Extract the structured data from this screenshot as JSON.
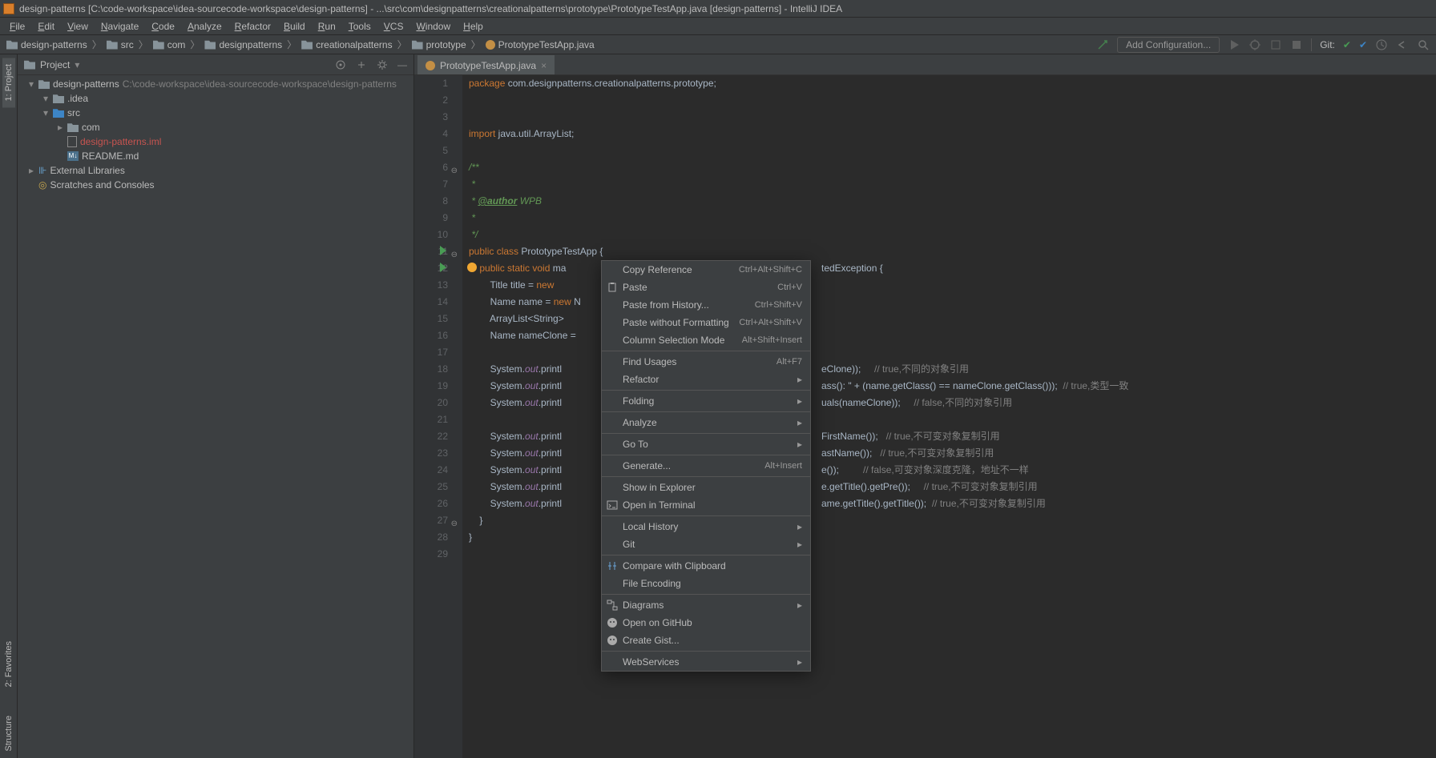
{
  "title": "design-patterns [C:\\code-workspace\\idea-sourcecode-workspace\\design-patterns] - ...\\src\\com\\designpatterns\\creationalpatterns\\prototype\\PrototypeTestApp.java [design-patterns] - IntelliJ IDEA",
  "menubar": [
    "File",
    "Edit",
    "View",
    "Navigate",
    "Code",
    "Analyze",
    "Refactor",
    "Build",
    "Run",
    "Tools",
    "VCS",
    "Window",
    "Help"
  ],
  "breadcrumbs": [
    "design-patterns",
    "src",
    "com",
    "designpatterns",
    "creationalpatterns",
    "prototype",
    "PrototypeTestApp.java"
  ],
  "navbar": {
    "addConfig": "Add Configuration...",
    "git": "Git:"
  },
  "leftTabs": {
    "project": "1: Project",
    "favorites": "2: Favorites",
    "structure": "Structure"
  },
  "panel": {
    "title": "Project",
    "tree": [
      {
        "indent": 0,
        "chev": "▾",
        "icon": "folder",
        "label": "design-patterns",
        "suffix": "C:\\code-workspace\\idea-sourcecode-workspace\\design-patterns",
        "cls": ""
      },
      {
        "indent": 1,
        "chev": "▾",
        "icon": "folder",
        "label": ".idea",
        "cls": ""
      },
      {
        "indent": 1,
        "chev": "▾",
        "icon": "folder-blue",
        "label": "src",
        "cls": ""
      },
      {
        "indent": 2,
        "chev": "▸",
        "icon": "folder",
        "label": "com",
        "cls": ""
      },
      {
        "indent": 2,
        "chev": "",
        "icon": "file",
        "label": "design-patterns.iml",
        "cls": "red"
      },
      {
        "indent": 2,
        "chev": "",
        "icon": "md",
        "label": "README.md",
        "cls": ""
      },
      {
        "indent": 0,
        "chev": "▸",
        "icon": "lib",
        "label": "External Libraries",
        "cls": ""
      },
      {
        "indent": 0,
        "chev": "",
        "icon": "scratch",
        "label": "Scratches and Consoles",
        "cls": ""
      }
    ]
  },
  "tab": {
    "label": "PrototypeTestApp.java"
  },
  "code": [
    {
      "n": 1,
      "html": "<span class='kw'>package</span> com.designpatterns.creationalpatterns.prototype;"
    },
    {
      "n": 2,
      "html": ""
    },
    {
      "n": 3,
      "html": ""
    },
    {
      "n": 4,
      "html": "<span class='kw'>import</span> java.util.ArrayList;"
    },
    {
      "n": 5,
      "html": ""
    },
    {
      "n": 6,
      "html": "<span class='jdoc'>/**</span>",
      "fold": "⊖"
    },
    {
      "n": 7,
      "html": "<span class='jdoc'> *</span>"
    },
    {
      "n": 8,
      "html": "<span class='jdoc'> * <span class='jdoc-tag'>@author</span> WPB</span>"
    },
    {
      "n": 9,
      "html": "<span class='jdoc'> *</span>"
    },
    {
      "n": 10,
      "html": "<span class='jdoc'> */</span>"
    },
    {
      "n": 11,
      "html": "<span class='kw'>public class</span> PrototypeTestApp {",
      "run": true,
      "fold": "⊖"
    },
    {
      "n": 12,
      "html": "    <span class='kw'>public static void</span> ma",
      "run": true,
      "bulb": true,
      "tail": "tedException {"
    },
    {
      "n": 13,
      "html": "        Title title = <span class='kw'>new</span>"
    },
    {
      "n": 14,
      "html": "        Name name = <span class='kw'>new</span> N"
    },
    {
      "n": 15,
      "html": "        ArrayList&lt;String&gt;"
    },
    {
      "n": 16,
      "html": "        Name nameClone = "
    },
    {
      "n": 17,
      "html": ""
    },
    {
      "n": 18,
      "html": "        System.<span class='field'>out</span>.printl",
      "tail": "eClone));     <span class='cmt'>// true,不同的对象引用</span>"
    },
    {
      "n": 19,
      "html": "        System.<span class='field'>out</span>.printl",
      "tail": "ass(): \" + (name.getClass() == nameClone.getClass()));  <span class='cmt'>// true,类型一致</span>"
    },
    {
      "n": 20,
      "html": "        System.<span class='field'>out</span>.printl",
      "tail": "uals(nameClone));     <span class='cmt'>// false,不同的对象引用</span>"
    },
    {
      "n": 21,
      "html": ""
    },
    {
      "n": 22,
      "html": "        System.<span class='field'>out</span>.printl",
      "tail": "FirstName());   <span class='cmt'>// true,不可变对象复制引用</span>"
    },
    {
      "n": 23,
      "html": "        System.<span class='field'>out</span>.printl",
      "tail": "astName());   <span class='cmt'>// true,不可变对象复制引用</span>"
    },
    {
      "n": 24,
      "html": "        System.<span class='field'>out</span>.printl",
      "tail": "e());         <span class='cmt'>// false,可变对象深度克隆，地址不一样</span>"
    },
    {
      "n": 25,
      "html": "        System.<span class='field'>out</span>.printl",
      "tail": "e.getTitle().getPre());     <span class='cmt'>// true,不可变对象复制引用</span>"
    },
    {
      "n": 26,
      "html": "        System.<span class='field'>out</span>.printl",
      "tail": "ame.getTitle().getTitle());  <span class='cmt'>// true,不可变对象复制引用</span>"
    },
    {
      "n": 27,
      "html": "    }",
      "fold": "⊖"
    },
    {
      "n": 28,
      "html": "}"
    },
    {
      "n": 29,
      "html": ""
    }
  ],
  "contextMenu": [
    {
      "label": "Copy Reference",
      "shortcut": "Ctrl+Alt+Shift+C"
    },
    {
      "label": "Paste",
      "shortcut": "Ctrl+V",
      "icon": "paste"
    },
    {
      "label": "Paste from History...",
      "shortcut": "Ctrl+Shift+V"
    },
    {
      "label": "Paste without Formatting",
      "shortcut": "Ctrl+Alt+Shift+V"
    },
    {
      "label": "Column Selection Mode",
      "shortcut": "Alt+Shift+Insert"
    },
    {
      "sep": true
    },
    {
      "label": "Find Usages",
      "shortcut": "Alt+F7"
    },
    {
      "label": "Refactor",
      "sub": true
    },
    {
      "sep": true
    },
    {
      "label": "Folding",
      "sub": true
    },
    {
      "sep": true
    },
    {
      "label": "Analyze",
      "sub": true
    },
    {
      "sep": true
    },
    {
      "label": "Go To",
      "sub": true
    },
    {
      "sep": true
    },
    {
      "label": "Generate...",
      "shortcut": "Alt+Insert"
    },
    {
      "sep": true
    },
    {
      "label": "Show in Explorer"
    },
    {
      "label": "Open in Terminal",
      "icon": "terminal"
    },
    {
      "sep": true
    },
    {
      "label": "Local History",
      "sub": true
    },
    {
      "label": "Git",
      "sub": true
    },
    {
      "sep": true
    },
    {
      "label": "Compare with Clipboard",
      "icon": "diff"
    },
    {
      "label": "File Encoding"
    },
    {
      "sep": true
    },
    {
      "label": "Diagrams",
      "sub": true,
      "icon": "diagram"
    },
    {
      "label": "Open on GitHub",
      "icon": "github"
    },
    {
      "label": "Create Gist...",
      "icon": "github"
    },
    {
      "sep": true
    },
    {
      "label": "WebServices",
      "sub": true
    }
  ]
}
